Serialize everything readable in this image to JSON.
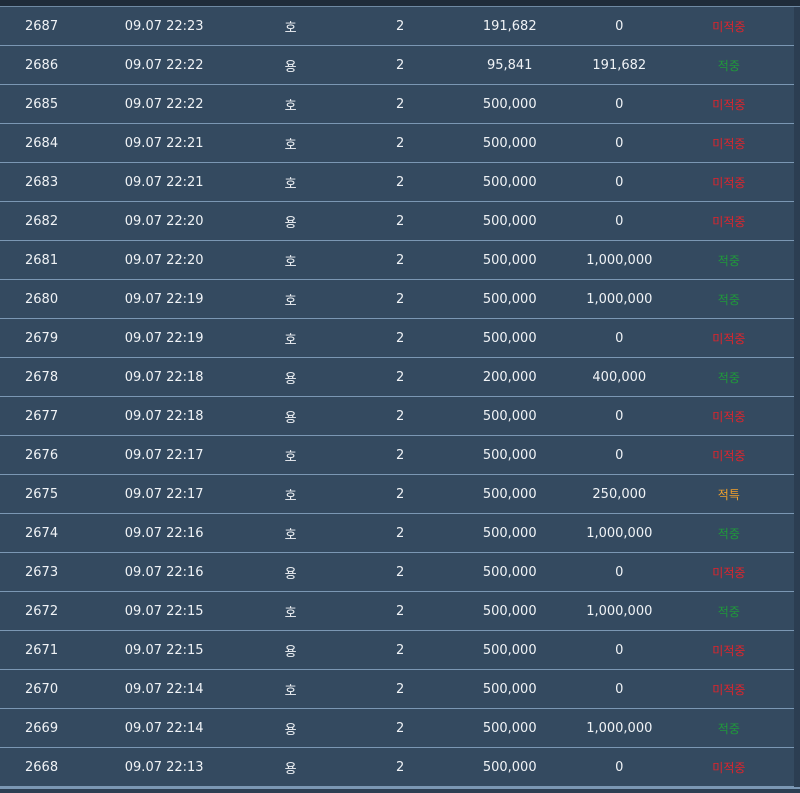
{
  "rows": [
    {
      "no": "2687",
      "date": "09.07 22:23",
      "pick": "호",
      "qty": "2",
      "bet": "191,682",
      "win": "0",
      "result": "미적중",
      "status": "miss"
    },
    {
      "no": "2686",
      "date": "09.07 22:22",
      "pick": "용",
      "qty": "2",
      "bet": "95,841",
      "win": "191,682",
      "result": "적중",
      "status": "hit"
    },
    {
      "no": "2685",
      "date": "09.07 22:22",
      "pick": "호",
      "qty": "2",
      "bet": "500,000",
      "win": "0",
      "result": "미적중",
      "status": "miss"
    },
    {
      "no": "2684",
      "date": "09.07 22:21",
      "pick": "호",
      "qty": "2",
      "bet": "500,000",
      "win": "0",
      "result": "미적중",
      "status": "miss"
    },
    {
      "no": "2683",
      "date": "09.07 22:21",
      "pick": "호",
      "qty": "2",
      "bet": "500,000",
      "win": "0",
      "result": "미적중",
      "status": "miss"
    },
    {
      "no": "2682",
      "date": "09.07 22:20",
      "pick": "용",
      "qty": "2",
      "bet": "500,000",
      "win": "0",
      "result": "미적중",
      "status": "miss"
    },
    {
      "no": "2681",
      "date": "09.07 22:20",
      "pick": "호",
      "qty": "2",
      "bet": "500,000",
      "win": "1,000,000",
      "result": "적중",
      "status": "hit"
    },
    {
      "no": "2680",
      "date": "09.07 22:19",
      "pick": "호",
      "qty": "2",
      "bet": "500,000",
      "win": "1,000,000",
      "result": "적중",
      "status": "hit"
    },
    {
      "no": "2679",
      "date": "09.07 22:19",
      "pick": "호",
      "qty": "2",
      "bet": "500,000",
      "win": "0",
      "result": "미적중",
      "status": "miss"
    },
    {
      "no": "2678",
      "date": "09.07 22:18",
      "pick": "용",
      "qty": "2",
      "bet": "200,000",
      "win": "400,000",
      "result": "적중",
      "status": "hit"
    },
    {
      "no": "2677",
      "date": "09.07 22:18",
      "pick": "용",
      "qty": "2",
      "bet": "500,000",
      "win": "0",
      "result": "미적중",
      "status": "miss"
    },
    {
      "no": "2676",
      "date": "09.07 22:17",
      "pick": "호",
      "qty": "2",
      "bet": "500,000",
      "win": "0",
      "result": "미적중",
      "status": "miss"
    },
    {
      "no": "2675",
      "date": "09.07 22:17",
      "pick": "호",
      "qty": "2",
      "bet": "500,000",
      "win": "250,000",
      "result": "적특",
      "status": "tie"
    },
    {
      "no": "2674",
      "date": "09.07 22:16",
      "pick": "호",
      "qty": "2",
      "bet": "500,000",
      "win": "1,000,000",
      "result": "적중",
      "status": "hit"
    },
    {
      "no": "2673",
      "date": "09.07 22:16",
      "pick": "용",
      "qty": "2",
      "bet": "500,000",
      "win": "0",
      "result": "미적중",
      "status": "miss"
    },
    {
      "no": "2672",
      "date": "09.07 22:15",
      "pick": "호",
      "qty": "2",
      "bet": "500,000",
      "win": "1,000,000",
      "result": "적중",
      "status": "hit"
    },
    {
      "no": "2671",
      "date": "09.07 22:15",
      "pick": "용",
      "qty": "2",
      "bet": "500,000",
      "win": "0",
      "result": "미적중",
      "status": "miss"
    },
    {
      "no": "2670",
      "date": "09.07 22:14",
      "pick": "호",
      "qty": "2",
      "bet": "500,000",
      "win": "0",
      "result": "미적중",
      "status": "miss"
    },
    {
      "no": "2669",
      "date": "09.07 22:14",
      "pick": "용",
      "qty": "2",
      "bet": "500,000",
      "win": "1,000,000",
      "result": "적중",
      "status": "hit"
    },
    {
      "no": "2668",
      "date": "09.07 22:13",
      "pick": "용",
      "qty": "2",
      "bet": "500,000",
      "win": "0",
      "result": "미적중",
      "status": "miss"
    }
  ],
  "colors": {
    "row_bg": "#344a60",
    "row_border": "#7b97b3",
    "miss": "#e0242b",
    "hit": "#1f9a3a",
    "tie": "#f2a12b"
  }
}
